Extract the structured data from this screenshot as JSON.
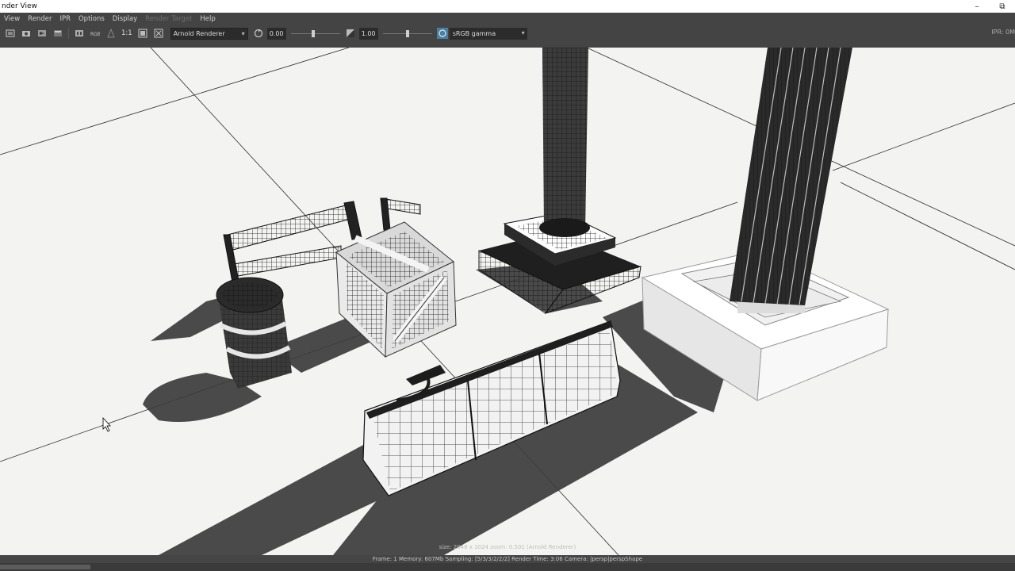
{
  "window": {
    "title": "nder View",
    "controls": [
      "minimize-icon",
      "restore-icon"
    ]
  },
  "menu": {
    "items": [
      {
        "label": "View",
        "enabled": true
      },
      {
        "label": "Render",
        "enabled": true
      },
      {
        "label": "IPR",
        "enabled": true
      },
      {
        "label": "Options",
        "enabled": true
      },
      {
        "label": "Display",
        "enabled": true
      },
      {
        "label": "Render Target",
        "enabled": false
      },
      {
        "label": "Help",
        "enabled": true
      }
    ]
  },
  "toolbar": {
    "icons": [
      "render-frame-icon",
      "snapshot-icon",
      "ipr-icon",
      "refresh-icon",
      "keep-image-icon",
      "rgb-icon",
      "display-alpha-icon"
    ],
    "ratio_label": "1:1",
    "renderer": "Arnold Renderer",
    "exposure_value": "0.00",
    "exposure_level": 0.45,
    "gamma_value": "1.00",
    "gamma_level": 0.5,
    "colorspace": "sRGB gamma",
    "ipr_label": "IPR: 0M"
  },
  "viewport": {
    "overlay_text": "size: 2048 x 1024  zoom: 0.501     (Arnold Renderer)"
  },
  "status": {
    "text": "Frame: 1    Memory: 607Mb    Sampling: [5/3/3/2/2/2]    Render Time: 3:06    Camera: |persp|perspShape"
  },
  "colors": {
    "ui_bg": "#444444",
    "field_bg": "#2b2b2b",
    "floor": "#f3f3f1",
    "shadow": "#3c3c3c",
    "accent": "#4a7fa0"
  }
}
